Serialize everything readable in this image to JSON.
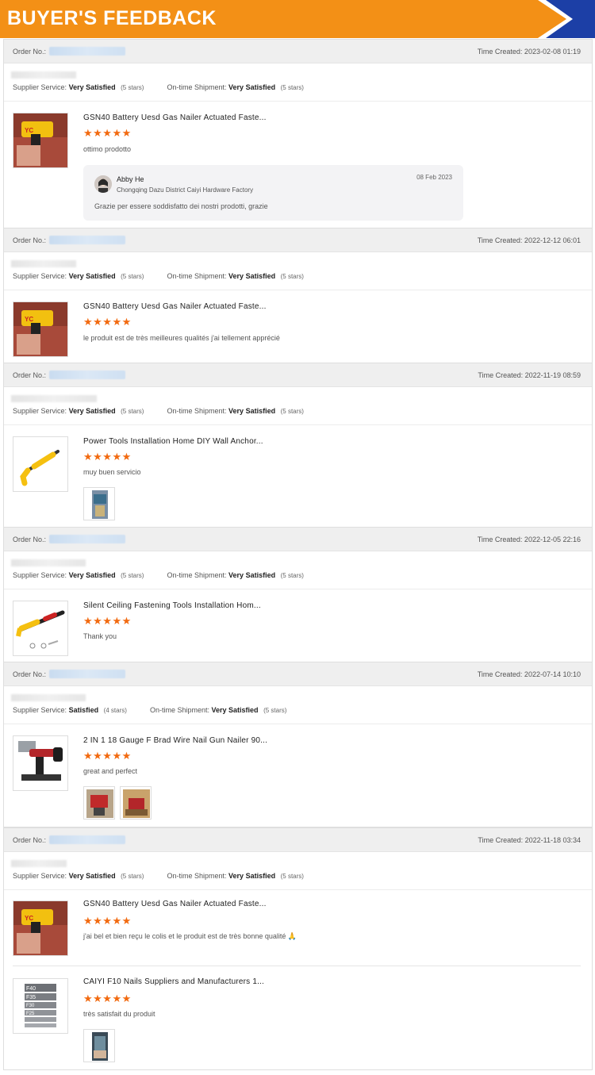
{
  "banner": {
    "title": "BUYER'S FEEDBACK"
  },
  "labels": {
    "order_no": "Order No.:",
    "supplier_service": "Supplier Service:",
    "ontime_shipment": "On-time Shipment:"
  },
  "reviews": [
    {
      "time_created": "Time Created: 2023-02-08 01:19",
      "supplier_rating": "Very Satisfied",
      "supplier_stars": "(5 stars)",
      "shipment_rating": "Very Satisfied",
      "shipment_stars": "(5 stars)",
      "items": [
        {
          "title": "GSN40 Battery Uesd Gas Nailer Actuated Faste...",
          "stars": "★★★★★",
          "comment": "ottimo  prodotto",
          "thumb_icon": "gas-nailer-photo"
        }
      ],
      "reply": {
        "name": "Abby He",
        "company": "Chongqing Dazu District Caiyi Hardware Factory",
        "date": "08 Feb 2023",
        "text": "Grazie per essere soddisfatto dei nostri prodotti, grazie"
      }
    },
    {
      "time_created": "Time Created: 2022-12-12 06:01",
      "supplier_rating": "Very Satisfied",
      "supplier_stars": "(5 stars)",
      "shipment_rating": "Very Satisfied",
      "shipment_stars": "(5 stars)",
      "items": [
        {
          "title": "GSN40 Battery Uesd Gas Nailer Actuated Faste...",
          "stars": "★★★★★",
          "comment": "le produit est de très meilleures qualités j'ai tellement apprécié",
          "thumb_icon": "gas-nailer-photo"
        }
      ]
    },
    {
      "time_created": "Time Created: 2022-11-19 08:59",
      "supplier_rating": "Very Satisfied",
      "supplier_stars": "(5 stars)",
      "shipment_rating": "Very Satisfied",
      "shipment_stars": "(5 stars)",
      "items": [
        {
          "title": "Power Tools Installation Home DIY Wall Anchor...",
          "stars": "★★★★★",
          "comment": "muy buen servicio",
          "thumb_icon": "yellow-fastening-tool-photo"
        }
      ]
    },
    {
      "time_created": "Time Created: 2022-12-05 22:16",
      "supplier_rating": "Very Satisfied",
      "supplier_stars": "(5 stars)",
      "shipment_rating": "Very Satisfied",
      "shipment_stars": "(5 stars)",
      "items": [
        {
          "title": "Silent Ceiling Fastening Tools Installation Hom...",
          "stars": "★★★★★",
          "comment": "Thank you",
          "thumb_icon": "ceiling-fastening-tool-photo"
        }
      ]
    },
    {
      "time_created": "Time Created: 2022-07-14 10:10",
      "supplier_rating": "Satisfied",
      "supplier_stars": "(4 stars)",
      "shipment_rating": "Very Satisfied",
      "shipment_stars": "(5 stars)",
      "items": [
        {
          "title": "2 IN 1 18 Gauge F Brad Wire Nail Gun Nailer 90...",
          "stars": "★★★★★",
          "comment": "great and perfect",
          "thumb_icon": "brad-nail-gun-photo"
        }
      ]
    },
    {
      "time_created": "Time Created: 2022-11-18 03:34",
      "supplier_rating": "Very Satisfied",
      "supplier_stars": "(5 stars)",
      "shipment_rating": "Very Satisfied",
      "shipment_stars": "(5 stars)",
      "items": [
        {
          "title": "GSN40 Battery Uesd Gas Nailer Actuated Faste...",
          "stars": "★★★★★",
          "comment": "j'ai bel et bien reçu le colis et le produit est de très bonne qualité 🙏",
          "thumb_icon": "gas-nailer-photo"
        },
        {
          "title": "CAIYI F10 Nails Suppliers and Manufacturers 1...",
          "stars": "★★★★★",
          "comment": "très satisfait du produit",
          "thumb_icon": "f-nails-photo",
          "thumb_labels": [
            "F40",
            "F35",
            "F30",
            "F25"
          ]
        }
      ]
    }
  ],
  "colors": {
    "banner_orange": "#f39016",
    "banner_blue": "#1c3fa6",
    "star_orange": "#f26a10"
  }
}
